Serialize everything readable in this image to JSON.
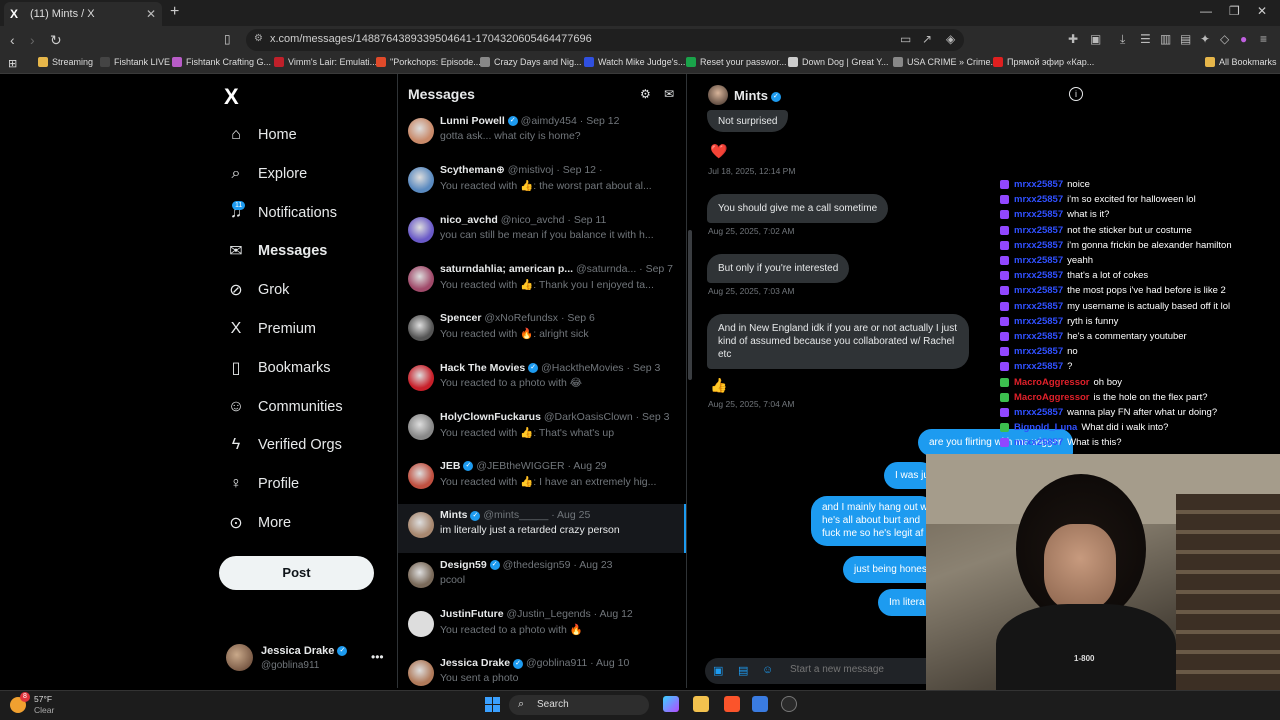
{
  "browser": {
    "tab_title": "(11) Mints / X",
    "url": "x.com/messages/1488764389339504641-1704320605464477696",
    "bookmarks": [
      {
        "label": "Streaming",
        "color": "#e6b64a"
      },
      {
        "label": "Fishtank LIVE",
        "color": "#444444"
      },
      {
        "label": "Fishtank Crafting G...",
        "color": "#b85cc8"
      },
      {
        "label": "Vimm's Lair: Emulati...",
        "color": "#c0202a"
      },
      {
        "label": "\"Porkchops: Episode...",
        "color": "#e04a2a"
      },
      {
        "label": "Crazy Days and Nig...",
        "color": "#888888"
      },
      {
        "label": "Watch Mike Judge's...",
        "color": "#3050e0"
      },
      {
        "label": "Reset your passwor...",
        "color": "#1aa34a"
      },
      {
        "label": "Down Dog | Great Y...",
        "color": "#cccccc"
      },
      {
        "label": "USA CRIME » Crime...",
        "color": "#888888"
      },
      {
        "label": "Прямой эфир «Кар...",
        "color": "#e02020"
      },
      {
        "label": "All Bookmarks",
        "color": "#e6b64a"
      }
    ]
  },
  "sidebar": {
    "brand": "X",
    "items": [
      {
        "label": "Home",
        "icon": "home-icon",
        "glyph": "⌂"
      },
      {
        "label": "Explore",
        "icon": "search-icon",
        "glyph": "⌕"
      },
      {
        "label": "Notifications",
        "icon": "bell-icon",
        "glyph": "♫"
      },
      {
        "label": "Messages",
        "icon": "envelope-icon",
        "glyph": "✉"
      },
      {
        "label": "Grok",
        "icon": "grok-icon",
        "glyph": "⊘"
      },
      {
        "label": "Premium",
        "icon": "x-icon",
        "glyph": "X"
      },
      {
        "label": "Bookmarks",
        "icon": "bookmark-icon",
        "glyph": "▯"
      },
      {
        "label": "Communities",
        "icon": "people-icon",
        "glyph": "☺"
      },
      {
        "label": "Verified Orgs",
        "icon": "lightning-icon",
        "glyph": "ϟ"
      },
      {
        "label": "Profile",
        "icon": "person-icon",
        "glyph": "♀"
      },
      {
        "label": "More",
        "icon": "more-circle-icon",
        "glyph": "⊙"
      }
    ],
    "notifications_count": "11",
    "post_label": "Post",
    "account": {
      "name": "Jessica Drake",
      "handle": "@goblina911"
    }
  },
  "messages": {
    "title": "Messages",
    "conversations": [
      {
        "name": "Lunni Powell",
        "verified": true,
        "meta": "@aimdy454 · Sep 12",
        "preview": "gotta ask... what city is home?",
        "color": "#c98a6a"
      },
      {
        "name": "Scytheman⊕",
        "verified": false,
        "meta": "@mistivoj · Sep 12 ·",
        "preview": "You reacted with 👍: the worst part about al...",
        "color": "#5a8ac0"
      },
      {
        "name": "nico_avchd",
        "verified": false,
        "meta": "@nico_avchd · Sep 11",
        "preview": "you can still be mean if you balance it with h...",
        "color": "#6a5ac8"
      },
      {
        "name": "saturndahlia; american p...",
        "verified": false,
        "meta": "@saturnda... · Sep 7",
        "preview": "You reacted with 👍: Thank you I enjoyed ta...",
        "color": "#a04a6a"
      },
      {
        "name": "Spencer",
        "verified": false,
        "meta": "@xNoRefundsx · Sep 6",
        "preview": "You reacted with 🔥: alright sick",
        "color": "#555555"
      },
      {
        "name": "Hack The Movies",
        "verified": true,
        "meta": "@HacktheMovies · Sep 3",
        "preview": "You reacted to a photo with 😂",
        "color": "#c8202a"
      },
      {
        "name": "HolyClownFuckarus",
        "verified": false,
        "meta": "@DarkOasisClown · Sep 3",
        "preview": "You reacted with 👍: That's what's up",
        "color": "#888888"
      },
      {
        "name": "JEB",
        "verified": true,
        "meta": "@JEBtheWIGGER · Aug 29",
        "preview": "You reacted with 👍: I have an extremely hig...",
        "color": "#c05040"
      },
      {
        "name": "Mints",
        "verified": true,
        "meta": "@mints_____ · Aug 25",
        "preview": "im literally just a retarded crazy person",
        "color": "#a88870",
        "selected": true
      },
      {
        "name": "Design59",
        "verified": true,
        "meta": "@thedesign59 · Aug 23",
        "preview": "pcool",
        "color": "#7a6a5a"
      },
      {
        "name": "JustinFuture",
        "verified": false,
        "meta": "@Justin_Legends · Aug 12",
        "preview": "You reacted to a photo with 🔥",
        "color": "#dddddd"
      },
      {
        "name": "Jessica Drake",
        "verified": true,
        "meta": "@goblina911 · Aug 10",
        "preview": "You sent a photo",
        "color": "#b07a5a"
      }
    ]
  },
  "chat": {
    "name": "Mints",
    "messages_in": [
      {
        "text": "Not surprised"
      },
      {
        "text": "You should give me a call sometime"
      },
      {
        "text": "But only if you're interested"
      },
      {
        "text": "And in New England idk if you are or not actually I just kind of assumed because you collaborated w/ Rachel etc"
      }
    ],
    "reactions": [
      "❤️",
      "👍"
    ],
    "timestamps": [
      "Jul 18, 2025, 12:14 PM",
      "Aug 25, 2025, 7:02 AM",
      "Aug 25, 2025, 7:03 AM",
      "Aug 25, 2025, 7:04 AM"
    ],
    "messages_out": [
      {
        "text": "are you flirting with me wigger"
      },
      {
        "text": "I was ju"
      },
      {
        "text": "and I mainly hang out w"
      },
      {
        "text": "he's all about burt and"
      },
      {
        "text": "fuck me so he's legit af"
      },
      {
        "text": "just being hones"
      },
      {
        "text": "Im litera"
      }
    ],
    "compose_placeholder": "Start a new message"
  },
  "stream_chat": [
    {
      "user": "mrxx25857",
      "text": "noice",
      "badge": "purple",
      "user_color": "blue"
    },
    {
      "user": "mrxx25857",
      "text": "i'm so excited for halloween lol",
      "badge": "purple",
      "user_color": "blue"
    },
    {
      "user": "mrxx25857",
      "text": "what is it?",
      "badge": "purple",
      "user_color": "blue"
    },
    {
      "user": "mrxx25857",
      "text": "not the sticker but ur costume",
      "badge": "purple",
      "user_color": "blue"
    },
    {
      "user": "mrxx25857",
      "text": "i'm gonna frickin be alexander hamilton",
      "badge": "purple",
      "user_color": "blue"
    },
    {
      "user": "mrxx25857",
      "text": "yeahh",
      "badge": "purple",
      "user_color": "blue"
    },
    {
      "user": "mrxx25857",
      "text": "that's a lot of cokes",
      "badge": "purple",
      "user_color": "blue"
    },
    {
      "user": "mrxx25857",
      "text": "the most pops i've had before is like 2",
      "badge": "purple",
      "user_color": "blue"
    },
    {
      "user": "mrxx25857",
      "text": "my username is actually based off it lol",
      "badge": "purple",
      "user_color": "blue"
    },
    {
      "user": "mrxx25857",
      "text": "ryth is funny",
      "badge": "purple",
      "user_color": "blue"
    },
    {
      "user": "mrxx25857",
      "text": "he's a commentary youtuber",
      "badge": "purple",
      "user_color": "blue"
    },
    {
      "user": "mrxx25857",
      "text": "no",
      "badge": "purple",
      "user_color": "blue"
    },
    {
      "user": "mrxx25857",
      "text": "?",
      "badge": "purple",
      "user_color": "blue"
    },
    {
      "user": "MacroAggressor",
      "text": "oh boy",
      "badge": "green",
      "user_color": "red"
    },
    {
      "user": "MacroAggressor",
      "text": "is the hole on the flex part?",
      "badge": "green",
      "user_color": "red"
    },
    {
      "user": "mrxx25857",
      "text": "wanna play FN after what ur doing?",
      "badge": "purple",
      "user_color": "blue"
    },
    {
      "user": "Bignold_Luna",
      "text": "What did i walk into?",
      "badge": "green",
      "user_color": "blue"
    },
    {
      "user": "mrxx25857",
      "text": "What is this?",
      "badge": "purple",
      "user_color": "blue"
    }
  ],
  "webcam": {
    "shirt_text": "1-800"
  },
  "taskbar": {
    "weather_temp": "57°F",
    "weather_desc": "Clear",
    "weather_badge": "8",
    "search_label": "Search"
  },
  "colors": {
    "accent": "#1d9bf0",
    "bg": "#000000",
    "bubble_in": "#2f3336"
  }
}
